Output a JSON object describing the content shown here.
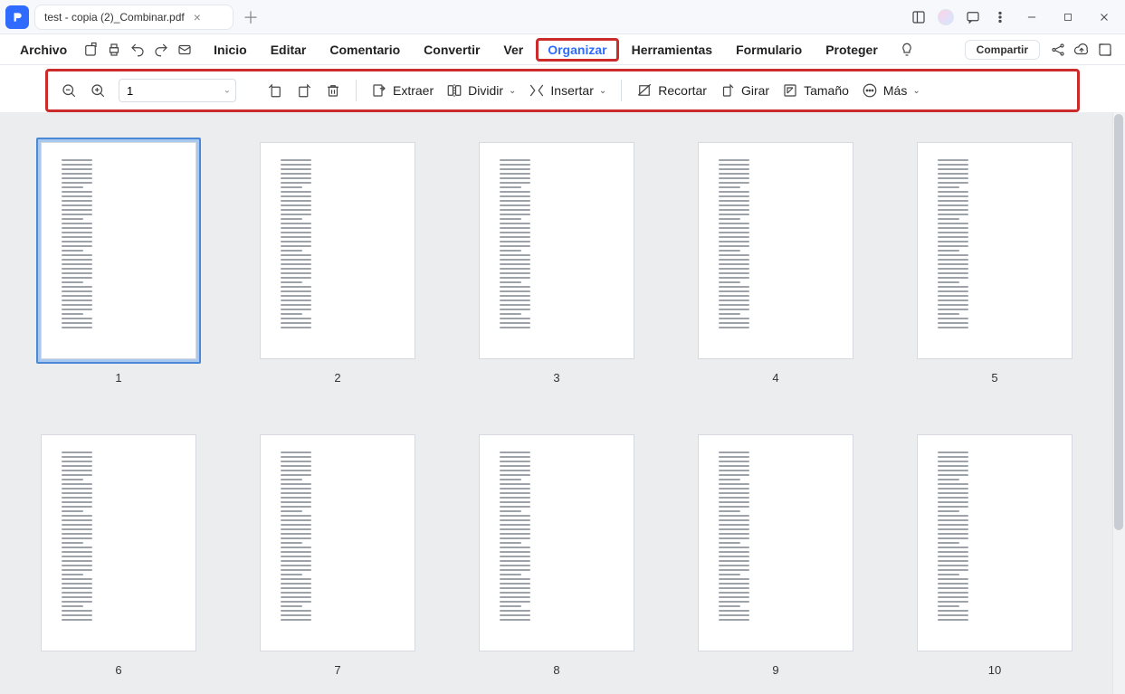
{
  "tab": {
    "title": "test - copia (2)_Combinar.pdf"
  },
  "menu": {
    "file": "Archivo",
    "items": [
      "Inicio",
      "Editar",
      "Comentario",
      "Convertir",
      "Ver",
      "Organizar",
      "Herramientas",
      "Formulario",
      "Proteger"
    ],
    "active": "Organizar",
    "share": "Compartir"
  },
  "toolbar": {
    "page_value": "1",
    "extract": "Extraer",
    "split": "Dividir",
    "insert": "Insertar",
    "crop": "Recortar",
    "rotate": "Girar",
    "size": "Tamaño",
    "more": "Más"
  },
  "pages": {
    "count": 10,
    "selected": 1,
    "labels": [
      "1",
      "2",
      "3",
      "4",
      "5",
      "6",
      "7",
      "8",
      "9",
      "10"
    ]
  }
}
